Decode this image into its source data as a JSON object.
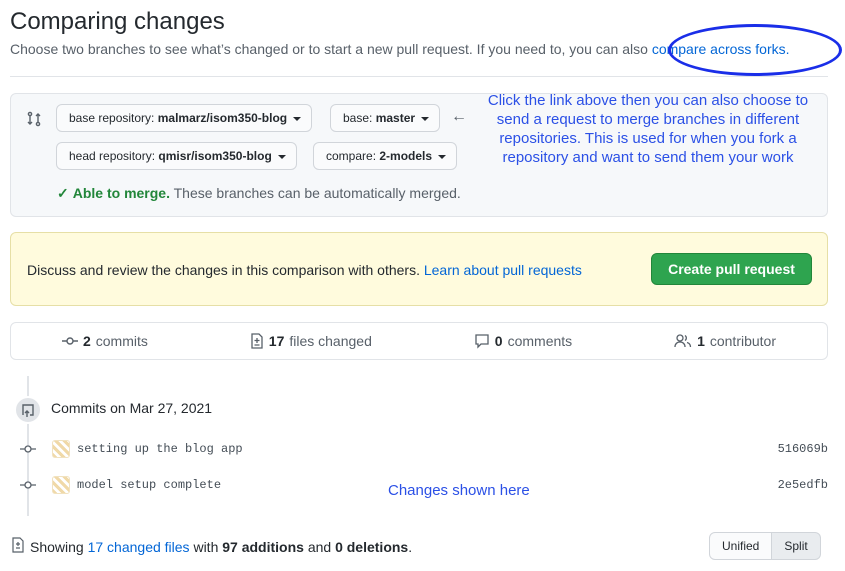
{
  "header": {
    "title": "Comparing changes",
    "subtitle": "Choose two branches to see what’s changed or to start a new pull request. If you need to, you can also",
    "forks_link": "compare across forks."
  },
  "range": {
    "base_repo_label": "base repository:",
    "base_repo_value": "malmarz/isom350-blog",
    "base_label": "base:",
    "base_value": "master",
    "head_repo_label": "head repository:",
    "head_repo_value": "qmisr/isom350-blog",
    "compare_label": "compare:",
    "compare_value": "2-models",
    "merge_ok": "Able to merge.",
    "merge_text": "These branches can be automatically merged."
  },
  "annotations": {
    "forks_note": "Click the link above then you can also choose to send a request to merge branches in different repositories. This is used for when you fork a repository and want to send them your work",
    "changes_note": "Changes shown here"
  },
  "flash": {
    "text": "Discuss and review the changes in this comparison with others.",
    "link": "Learn about pull requests",
    "button": "Create pull request"
  },
  "summary": {
    "commits_count": "2",
    "commits_label": "commits",
    "files_count": "17",
    "files_label": "files changed",
    "comments_count": "0",
    "comments_label": "comments",
    "contributors_count": "1",
    "contributors_label": "contributor"
  },
  "commits": {
    "day": "Commits on Mar 27, 2021",
    "items": [
      {
        "message": "setting up the blog app",
        "sha": "516069b"
      },
      {
        "message": "model setup complete",
        "sha": "2e5edfb"
      }
    ]
  },
  "diff": {
    "showing": "Showing",
    "files_link": "17 changed files",
    "with": "with",
    "additions": "97 additions",
    "and": "and",
    "deletions": "0 deletions",
    "end": ".",
    "unified": "Unified",
    "split": "Split"
  },
  "colors": {
    "accent": "#0366d6",
    "primary_button": "#2ea44f",
    "annotation": "#2b50e6",
    "merge_ok": "#22863a"
  }
}
